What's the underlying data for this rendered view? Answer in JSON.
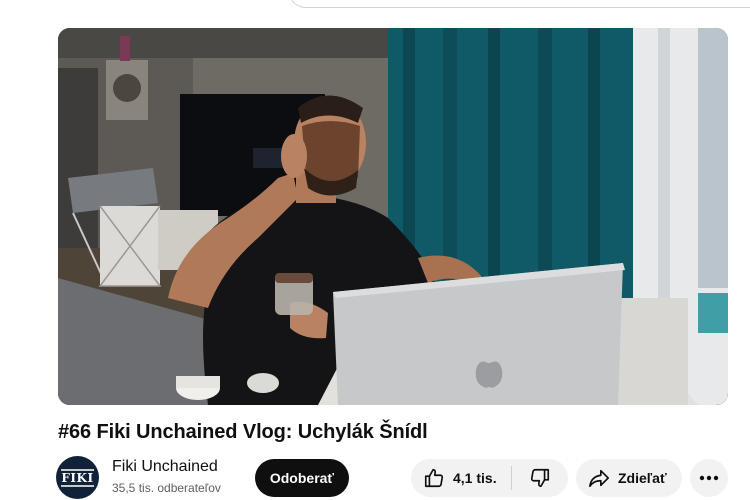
{
  "video": {
    "title": "#66 Fiki Unchained Vlog: Uchylák Šnídl"
  },
  "channel": {
    "name": "Fiki Unchained",
    "subscribers": "35,5 tis. odberateľov",
    "avatar_text": "FIKI"
  },
  "actions": {
    "subscribe_label": "Odoberať",
    "like_count": "4,1 tis.",
    "share_label": "Zdieľať"
  },
  "icons": {
    "like": "thumbs-up-icon",
    "dislike": "thumbs-down-icon",
    "share": "share-arrow-icon",
    "more": "more-horizontal-icon"
  },
  "colors": {
    "subscribe_bg": "#0f0f0f",
    "pill_bg": "#f2f2f2",
    "secondary_text": "#606060"
  }
}
